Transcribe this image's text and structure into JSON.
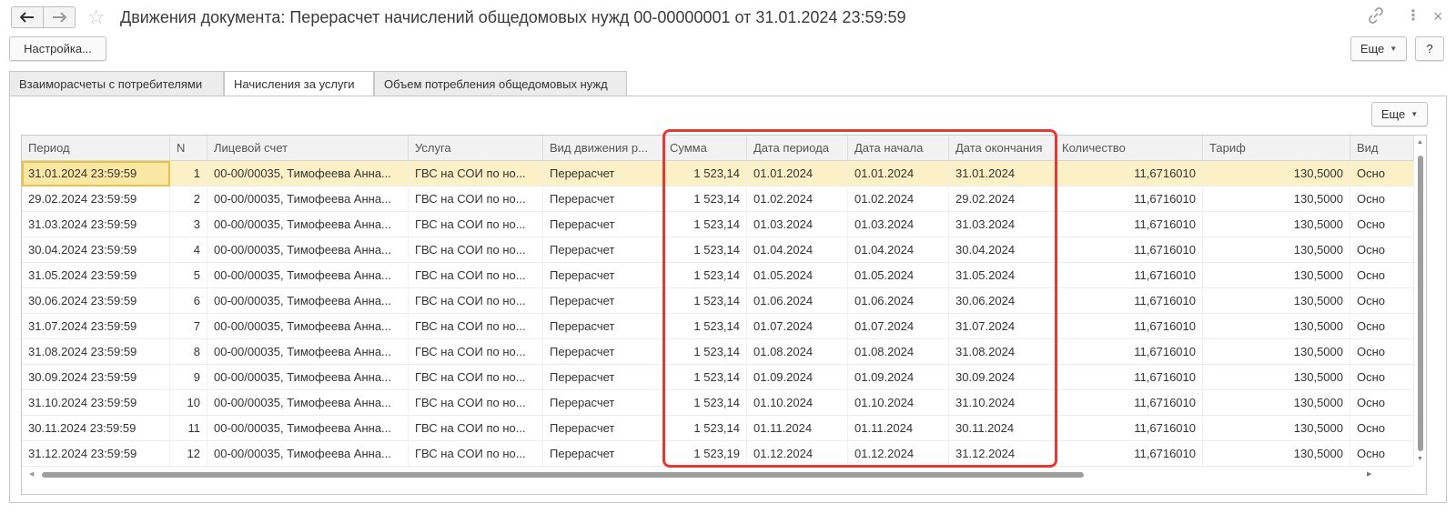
{
  "window": {
    "title": "Движения документа: Перерасчет начислений общедомовых нужд 00-00000001 от 31.01.2024 23:59:59",
    "back_icon": "arrow-left-icon",
    "forward_icon": "arrow-right-icon",
    "favorite_icon": "star-icon",
    "link_icon": "link-icon",
    "more_icon": "vertical-dots-icon",
    "close_icon": "close-icon"
  },
  "toolbar": {
    "settings_label": "Настройка...",
    "more_label": "Еще",
    "help_label": "?"
  },
  "tabs": [
    {
      "label": "Взаиморасчеты с потребителями",
      "active": false
    },
    {
      "label": "Начисления за услуги",
      "active": true
    },
    {
      "label": "Объем потребления общедомовых нужд",
      "active": false
    }
  ],
  "panel": {
    "more_label": "Еще"
  },
  "table": {
    "columns": [
      "Период",
      "N",
      "Лицевой счет",
      "Услуга",
      "Вид движения р...",
      "Сумма",
      "Дата периода",
      "Дата начала",
      "Дата окончания",
      "Количество",
      "Тариф",
      "Вид"
    ],
    "rows": [
      [
        "31.01.2024 23:59:59",
        "1",
        "00-00/00035, Тимофеева Анна...",
        "ГВС на СОИ по но...",
        "Перерасчет",
        "1 523,14",
        "01.01.2024",
        "01.01.2024",
        "31.01.2024",
        "11,6716010",
        "130,5000",
        "Осно"
      ],
      [
        "29.02.2024 23:59:59",
        "2",
        "00-00/00035, Тимофеева Анна...",
        "ГВС на СОИ по но...",
        "Перерасчет",
        "1 523,14",
        "01.02.2024",
        "01.02.2024",
        "29.02.2024",
        "11,6716010",
        "130,5000",
        "Осно"
      ],
      [
        "31.03.2024 23:59:59",
        "3",
        "00-00/00035, Тимофеева Анна...",
        "ГВС на СОИ по но...",
        "Перерасчет",
        "1 523,14",
        "01.03.2024",
        "01.03.2024",
        "31.03.2024",
        "11,6716010",
        "130,5000",
        "Осно"
      ],
      [
        "30.04.2024 23:59:59",
        "4",
        "00-00/00035, Тимофеева Анна...",
        "ГВС на СОИ по но...",
        "Перерасчет",
        "1 523,14",
        "01.04.2024",
        "01.04.2024",
        "30.04.2024",
        "11,6716010",
        "130,5000",
        "Осно"
      ],
      [
        "31.05.2024 23:59:59",
        "5",
        "00-00/00035, Тимофеева Анна...",
        "ГВС на СОИ по но...",
        "Перерасчет",
        "1 523,14",
        "01.05.2024",
        "01.05.2024",
        "31.05.2024",
        "11,6716010",
        "130,5000",
        "Осно"
      ],
      [
        "30.06.2024 23:59:59",
        "6",
        "00-00/00035, Тимофеева Анна...",
        "ГВС на СОИ по но...",
        "Перерасчет",
        "1 523,14",
        "01.06.2024",
        "01.06.2024",
        "30.06.2024",
        "11,6716010",
        "130,5000",
        "Осно"
      ],
      [
        "31.07.2024 23:59:59",
        "7",
        "00-00/00035, Тимофеева Анна...",
        "ГВС на СОИ по но...",
        "Перерасчет",
        "1 523,14",
        "01.07.2024",
        "01.07.2024",
        "31.07.2024",
        "11,6716010",
        "130,5000",
        "Осно"
      ],
      [
        "31.08.2024 23:59:59",
        "8",
        "00-00/00035, Тимофеева Анна...",
        "ГВС на СОИ по но...",
        "Перерасчет",
        "1 523,14",
        "01.08.2024",
        "01.08.2024",
        "31.08.2024",
        "11,6716010",
        "130,5000",
        "Осно"
      ],
      [
        "30.09.2024 23:59:59",
        "9",
        "00-00/00035, Тимофеева Анна...",
        "ГВС на СОИ по но...",
        "Перерасчет",
        "1 523,14",
        "01.09.2024",
        "01.09.2024",
        "30.09.2024",
        "11,6716010",
        "130,5000",
        "Осно"
      ],
      [
        "31.10.2024 23:59:59",
        "10",
        "00-00/00035, Тимофеева Анна...",
        "ГВС на СОИ по но...",
        "Перерасчет",
        "1 523,14",
        "01.10.2024",
        "01.10.2024",
        "31.10.2024",
        "11,6716010",
        "130,5000",
        "Осно"
      ],
      [
        "30.11.2024 23:59:59",
        "11",
        "00-00/00035, Тимофеева Анна...",
        "ГВС на СОИ по но...",
        "Перерасчет",
        "1 523,14",
        "01.11.2024",
        "01.11.2024",
        "30.11.2024",
        "11,6716010",
        "130,5000",
        "Осно"
      ],
      [
        "31.12.2024 23:59:59",
        "12",
        "00-00/00035, Тимофеева Анна...",
        "ГВС на СОИ по но...",
        "Перерасчет",
        "1 523,19",
        "01.12.2024",
        "01.12.2024",
        "31.12.2024",
        "11,6716010",
        "130,5000",
        "Осно"
      ]
    ],
    "selected_row": 0
  },
  "colors": {
    "selected_row_bg": "#fbf0c6",
    "focus_cell_border": "#e8c14a",
    "highlight_border": "#e53935"
  }
}
